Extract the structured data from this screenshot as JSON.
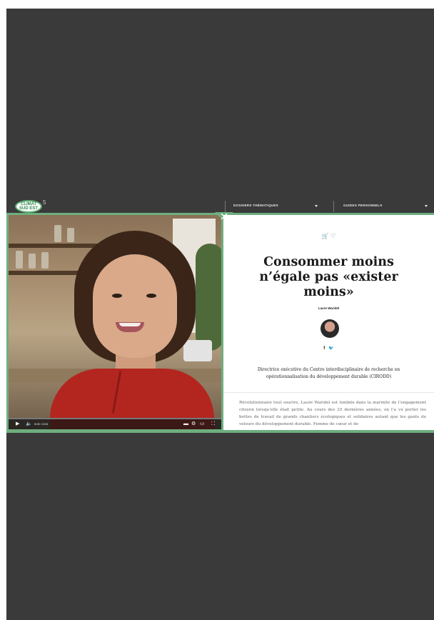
{
  "nav": {
    "logo_line1": "CLIMAT",
    "logo_line2": "SUD EST",
    "logo_badge": "5",
    "dossiers_label": "DOSSIERS THÉMATIQUES",
    "guides_label": "GUIDES PERSONNELS"
  },
  "video": {
    "time": "0:00 / 3:03",
    "progress": 0.0,
    "play_icon": "play-icon",
    "volume_icon": "volume-icon"
  },
  "article": {
    "icons": "🛒 ♡",
    "title": "Consommer moins n’égale pas «exister moins»",
    "author": "Laure Waridel",
    "social_facebook": "f",
    "social_twitter": "🐦",
    "subtitle": "Directrice exécutive du Centre interdisciplinaire de recherche en opérationnalisation du développement durable (CIRODD)",
    "body": "Révolutionnaire tout sourire, Laure Waridel est tombée dans la marmite de l’engagement citoyen lorsqu’elle était petite. Au cours des 25 dernières années, on l’a vu porter les bottes de travail de grands chantiers écologiques et solidaires autant que les gants de velours du développement durable. Femme de cœur et de"
  },
  "colors": {
    "accent": "#6fae7f",
    "background": "#3a3a3a"
  }
}
